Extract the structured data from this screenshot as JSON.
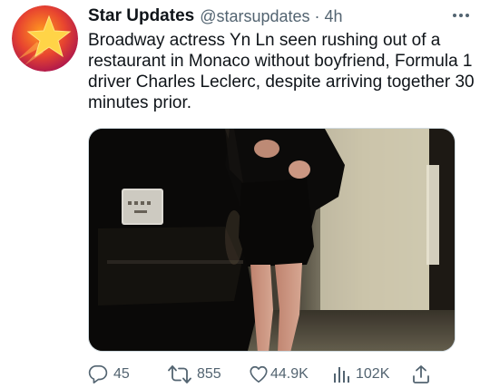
{
  "tweet": {
    "author_name": "Star Updates",
    "author_handle": "@starsupdates",
    "separator": "·",
    "timestamp": "4h",
    "more_icon": "more-horizontal-icon",
    "text": "Broadway actress Yn Ln seen rushing out of a restaurant in Monaco without boyfriend, Formula 1 driver Charles Leclerc, despite arriving together 30 minutes prior.",
    "avatar": {
      "icon": "star-icon",
      "colors": {
        "outer": "#c2185b",
        "inner": "#f57c00",
        "star": "#ffd54f"
      }
    }
  },
  "actions": {
    "reply": {
      "icon": "reply-icon",
      "count": "45"
    },
    "retweet": {
      "icon": "retweet-icon",
      "count": "855"
    },
    "like": {
      "icon": "heart-icon",
      "count": "44.9K"
    },
    "views": {
      "icon": "analytics-icon",
      "count": "102K"
    },
    "share": {
      "icon": "share-icon"
    }
  },
  "colors": {
    "text_primary": "#0f1419",
    "text_secondary": "#536471",
    "border": "#cfd9de"
  }
}
